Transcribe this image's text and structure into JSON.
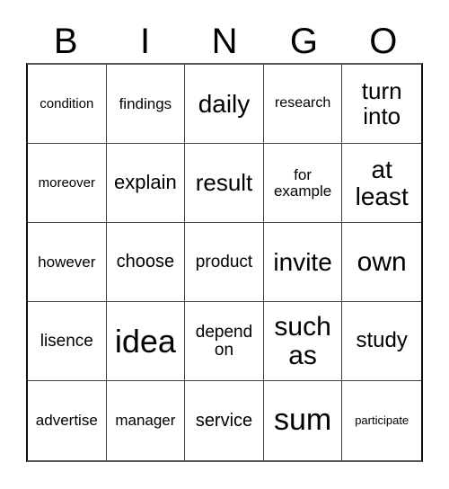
{
  "card": {
    "title_letters": [
      "B",
      "I",
      "N",
      "G",
      "O"
    ],
    "columns": 5,
    "rows": 5,
    "grid_color": "#444444",
    "border_color": "#111111",
    "background_color": "#ffffff",
    "text_color": "#000000"
  },
  "cells": [
    {
      "text": "condition",
      "size": "fs-15",
      "column": "B",
      "row": 1
    },
    {
      "text": "findings",
      "size": "fs-17",
      "column": "I",
      "row": 1
    },
    {
      "text": "daily",
      "size": "fs-28",
      "column": "N",
      "row": 1
    },
    {
      "text": "research",
      "size": "fs-16",
      "column": "G",
      "row": 1
    },
    {
      "text": "turn\ninto",
      "size": "fs-26",
      "column": "O",
      "row": 1
    },
    {
      "text": "moreover",
      "size": "fs-15",
      "column": "B",
      "row": 2
    },
    {
      "text": "explain",
      "size": "fs-22",
      "column": "I",
      "row": 2
    },
    {
      "text": "result",
      "size": "fs-26",
      "column": "N",
      "row": 2
    },
    {
      "text": "for\nexample",
      "size": "fs-17",
      "column": "G",
      "row": 2
    },
    {
      "text": "at\nleast",
      "size": "fs-28",
      "column": "O",
      "row": 2
    },
    {
      "text": "however",
      "size": "fs-17",
      "column": "B",
      "row": 3
    },
    {
      "text": "choose",
      "size": "fs-20",
      "column": "I",
      "row": 3
    },
    {
      "text": "product",
      "size": "fs-19",
      "column": "N",
      "row": 3
    },
    {
      "text": "invite",
      "size": "fs-28",
      "column": "G",
      "row": 3
    },
    {
      "text": "own",
      "size": "fs-30",
      "column": "O",
      "row": 3
    },
    {
      "text": "lisence",
      "size": "fs-19",
      "column": "B",
      "row": 4
    },
    {
      "text": "idea",
      "size": "fs-36",
      "column": "I",
      "row": 4
    },
    {
      "text": "depend\non",
      "size": "fs-19",
      "column": "N",
      "row": 4
    },
    {
      "text": "such\nas",
      "size": "fs-30",
      "column": "G",
      "row": 4
    },
    {
      "text": "study",
      "size": "fs-24",
      "column": "O",
      "row": 4
    },
    {
      "text": "advertise",
      "size": "fs-17",
      "column": "B",
      "row": 5
    },
    {
      "text": "manager",
      "size": "fs-17",
      "column": "I",
      "row": 5
    },
    {
      "text": "service",
      "size": "fs-20",
      "column": "N",
      "row": 5
    },
    {
      "text": "sum",
      "size": "fs-34",
      "column": "G",
      "row": 5
    },
    {
      "text": "participate",
      "size": "fs-13",
      "column": "O",
      "row": 5
    }
  ]
}
